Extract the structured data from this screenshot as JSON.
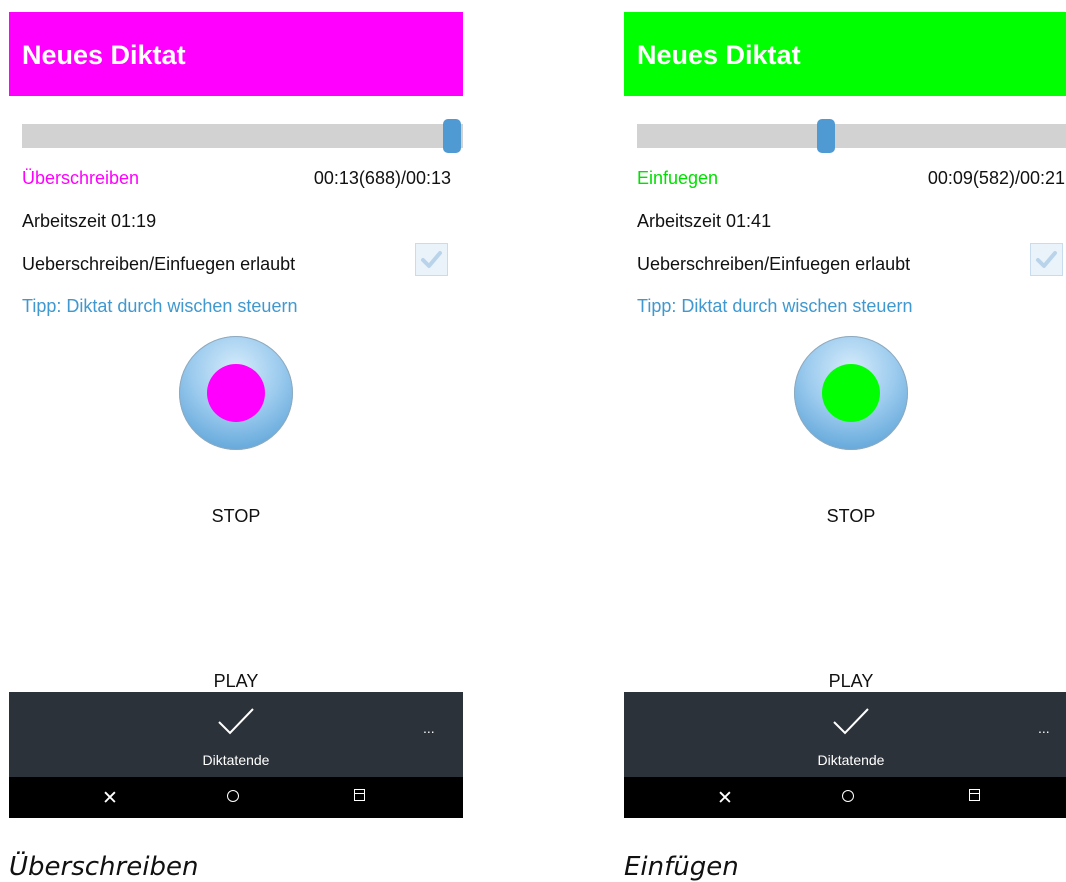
{
  "left_phone": {
    "accent_color": "#ff00ff",
    "title": "Neues Diktat",
    "seek_position": 0.975,
    "mode": "Überschreiben",
    "time": "00:13(688)/00:13",
    "work_time": "Arbeitszeit 01:19",
    "permit_label": "Ueberschreiben/Einfuegen erlaubt",
    "permit_checked": true,
    "tip": "Tipp: Diktat durch wischen steuern",
    "stop_label": "STOP",
    "play_label": "PLAY",
    "done_label": "Diktatende",
    "overflow": "..."
  },
  "right_phone": {
    "accent_color": "#00ff00",
    "title": "Neues Diktat",
    "seek_position": 0.44,
    "mode": "Einfuegen",
    "time": "00:09(582)/00:21",
    "work_time": "Arbeitszeit 01:41",
    "permit_label": "Ueberschreiben/Einfuegen erlaubt",
    "permit_checked": true,
    "tip": "Tipp: Diktat durch wischen steuern",
    "stop_label": "STOP",
    "play_label": "PLAY",
    "done_label": "Diktatende",
    "overflow": "..."
  },
  "captions": {
    "left": "Überschreiben",
    "right": "Einfügen"
  },
  "icons": {
    "done": "checkmark-icon",
    "back": "close-icon",
    "home": "circle-icon",
    "recent": "recent-apps-icon",
    "check": "check-icon"
  }
}
